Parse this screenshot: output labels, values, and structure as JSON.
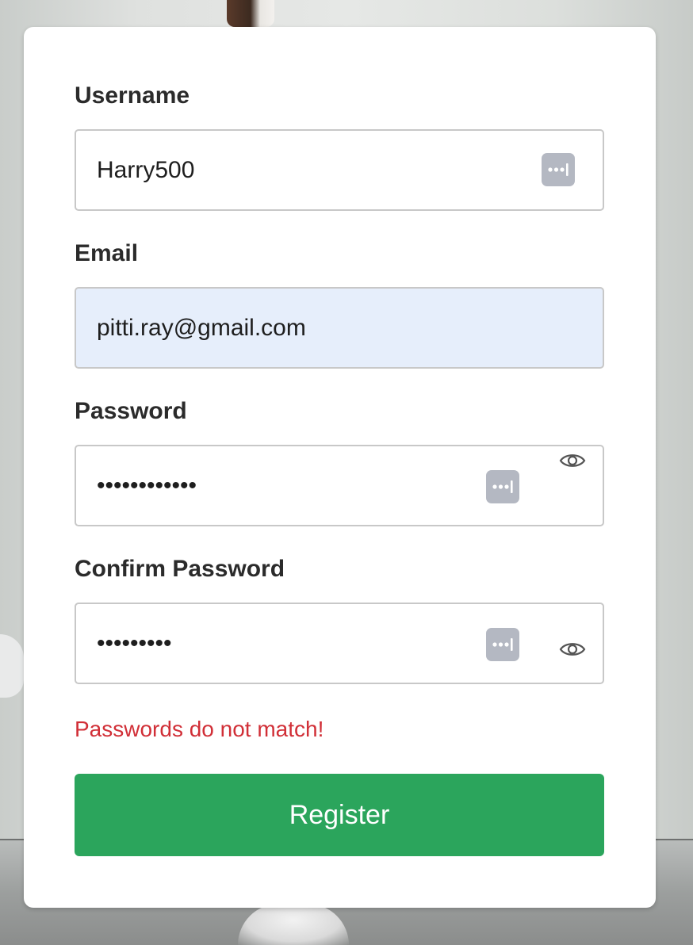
{
  "form": {
    "username": {
      "label": "Username",
      "value": "Harry500"
    },
    "email": {
      "label": "Email",
      "value": "pitti.ray@gmail.com"
    },
    "password": {
      "label": "Password",
      "value": "••••••••••••"
    },
    "confirm_password": {
      "label": "Confirm Password",
      "value": "•••••••••"
    },
    "error_message": "Passwords do not match!",
    "submit_label": "Register"
  },
  "icons": {
    "password_manager": "password-manager-icon",
    "toggle_visibility": "eye-icon"
  },
  "colors": {
    "accent": "#2ba55c",
    "error": "#d12f37",
    "autofill_bg": "#e6eefb",
    "card_bg": "#ffffff"
  }
}
